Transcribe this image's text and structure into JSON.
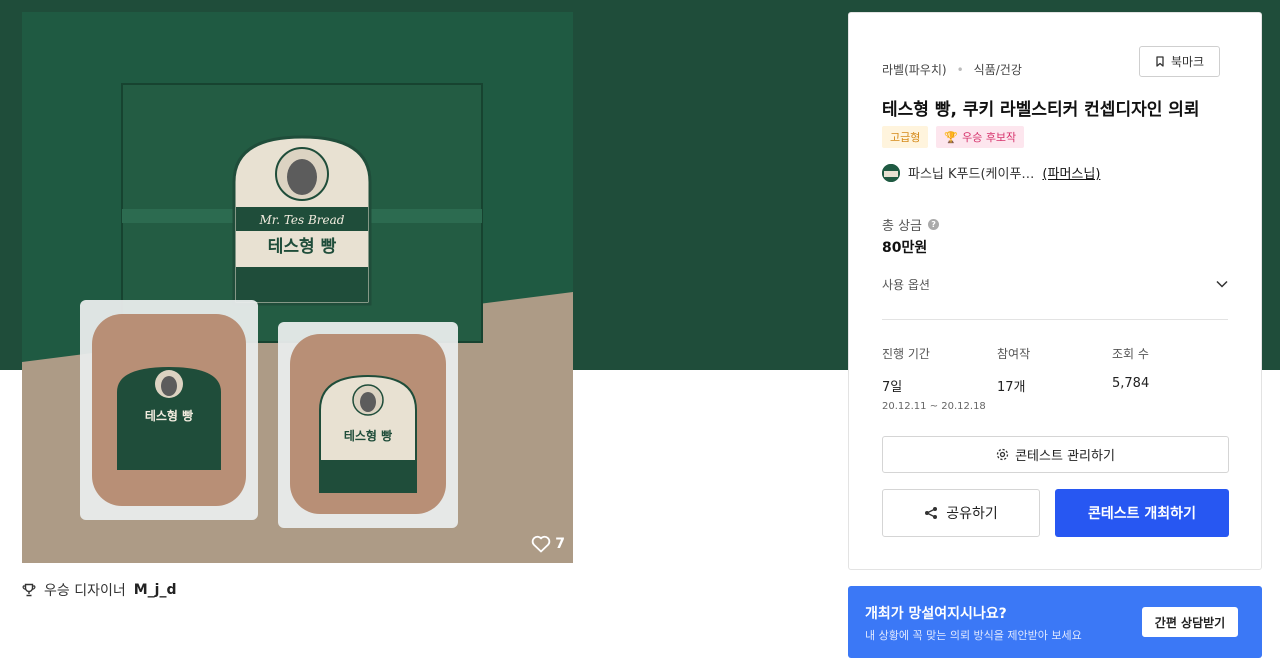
{
  "colors": {
    "band": "#1f4d3a",
    "primary": "#2757f2",
    "promo": "#3b78f6"
  },
  "hero": {
    "box_brand": "Mr. Tes Bread",
    "box_product": "테스형 빵",
    "likes": "7",
    "like_icon": "heart-outline-icon"
  },
  "winner": {
    "prefix": "우승 디자이너",
    "name": "M_j_d",
    "icon": "trophy-icon"
  },
  "card": {
    "bookmark_label": "북마크",
    "breadcrumb": [
      "라벨(파우치)",
      "식품/건강"
    ],
    "title": "테스형 빵, 쿠키 라벨스티커 컨셉디자인 의뢰",
    "badges": {
      "grade": "고급형",
      "prize": "우승 후보작"
    },
    "host": {
      "name": "파스닙 K푸드(케이푸…",
      "partner": "(파머스닙)"
    },
    "prize_label": "총 상금",
    "prize_value": "80만원",
    "options_label": "사용 옵션",
    "stats": {
      "period_label": "진행 기간",
      "period_value": "7일",
      "period_range": "20.12.11 ~ 20.12.18",
      "entries_label": "참여작",
      "entries_value": "17개",
      "views_label": "조회 수",
      "views_value": "5,784"
    },
    "manage_label": "콘테스트 관리하기",
    "share_label": "공유하기",
    "host_label": "콘테스트 개최하기"
  },
  "promo": {
    "question": "개최가 망설여지시나요?",
    "sub": "내 상황에 꼭 맞는 의뢰 방식을 제안받아 보세요",
    "button": "간편 상담받기"
  }
}
